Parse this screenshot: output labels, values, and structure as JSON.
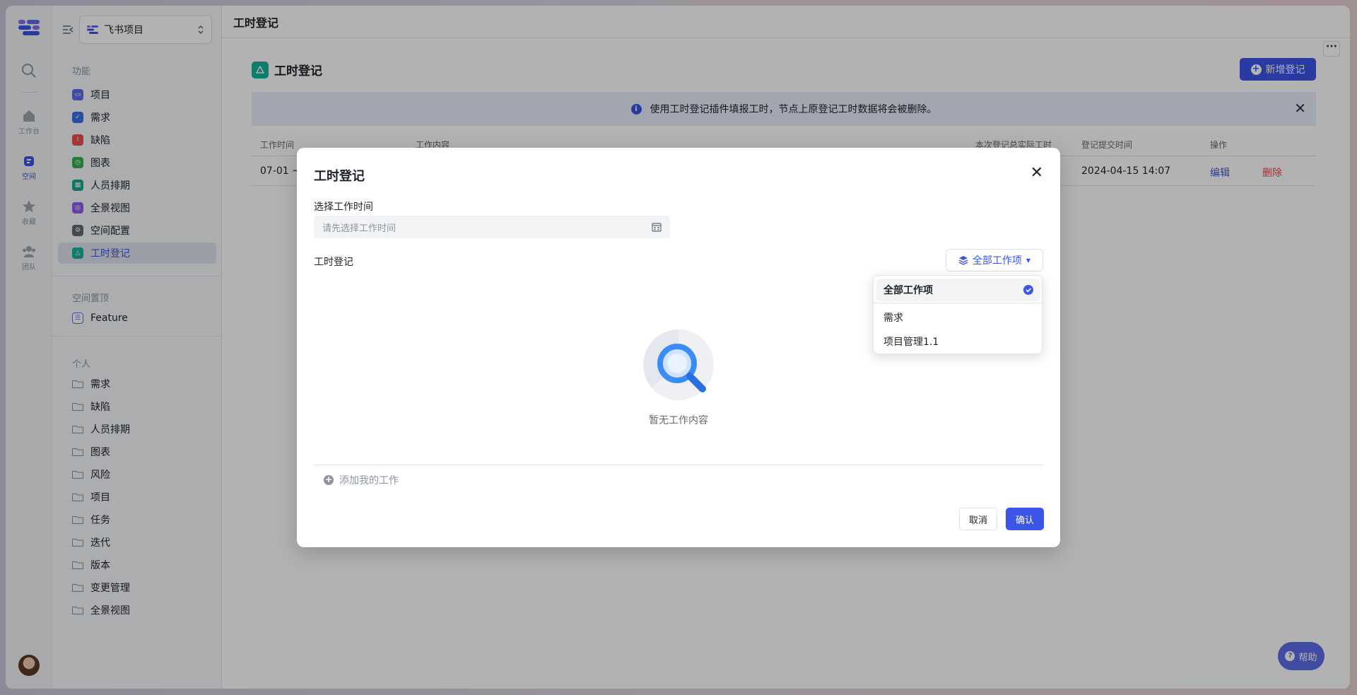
{
  "rail": {
    "items": [
      {
        "label": "工作台",
        "icon": "home-icon"
      },
      {
        "label": "空间",
        "icon": "space-icon"
      },
      {
        "label": "收藏",
        "icon": "star-icon"
      },
      {
        "label": "团队",
        "icon": "team-icon"
      }
    ]
  },
  "sidebar": {
    "project_name": "飞书项目",
    "features_title": "功能",
    "features": [
      {
        "label": "项目",
        "color": "#5b6ee8"
      },
      {
        "label": "需求",
        "color": "#3b6fe6"
      },
      {
        "label": "缺陷",
        "color": "#f04d4d"
      },
      {
        "label": "图表",
        "color": "#34b350"
      },
      {
        "label": "人员排期",
        "color": "#12a98e"
      },
      {
        "label": "全景视图",
        "color": "#8e5cf0"
      },
      {
        "label": "空间配置",
        "color": "#646a73"
      },
      {
        "label": "工时登记",
        "color": "#12b39a"
      }
    ],
    "pinned_title": "空间置顶",
    "pinned": [
      {
        "label": "Feature"
      }
    ],
    "personal_title": "个人",
    "personal": [
      "需求",
      "缺陷",
      "人员排期",
      "图表",
      "风险",
      "项目",
      "任务",
      "迭代",
      "版本",
      "变更管理",
      "全景视图"
    ]
  },
  "main": {
    "topbar_title": "工时登记",
    "page_title": "工时登记",
    "add_button": "新增登记",
    "notice": "使用工时登记插件填报工时，节点上原登记工时数据将会被删除。",
    "table": {
      "headers": [
        "工作时间",
        "工作内容",
        "本次登记总实际工时",
        "登记提交时间",
        "操作"
      ],
      "row": {
        "time": "07-01 ~",
        "submitted": "2024-04-15 14:07",
        "edit": "编辑",
        "delete": "删除"
      }
    },
    "help": "帮助"
  },
  "modal": {
    "title": "工时登记",
    "time_label": "选择工作时间",
    "time_placeholder": "请先选择工作时间",
    "section_label": "工时登记",
    "filter_label": "全部工作项",
    "empty_text": "暂无工作内容",
    "add_work": "添加我的工作",
    "cancel": "取消",
    "confirm": "确认"
  },
  "dropdown": {
    "options": [
      "全部工作项",
      "需求",
      "项目管理1.1"
    ],
    "selected": "全部工作项"
  },
  "colors": {
    "accent": "#3b55e6",
    "danger": "#e5484d",
    "notice_bg": "#e8eefc"
  }
}
